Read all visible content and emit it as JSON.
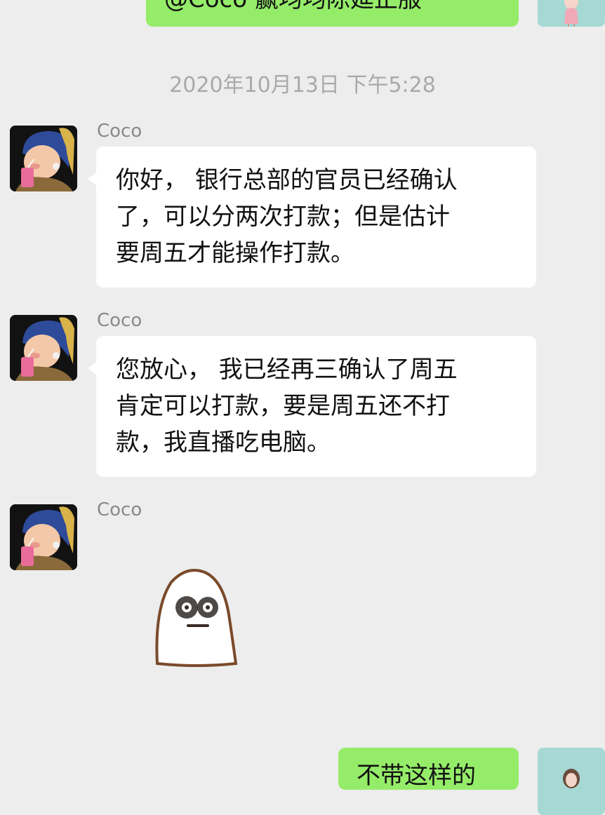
{
  "messages": {
    "out_top": {
      "text": "@Coco 赢均均陈延正服"
    },
    "timestamp": "2020年10月13日 下午5:28",
    "msg1": {
      "sender": "Coco",
      "lines": [
        "你好， 银行总部的官员已经确认",
        "了，可以分两次打款；但是估计",
        "要周五才能操作打款。"
      ]
    },
    "msg2": {
      "sender": "Coco",
      "lines": [
        "您放心， 我已经再三确认了周五",
        "肯定可以打款，要是周五还不打",
        "款，我直播吃电脑。"
      ]
    },
    "msg3": {
      "sender": "Coco",
      "sticker_icon": "ghost-face-sticker"
    },
    "out_bottom": {
      "text": "不带这样的"
    }
  },
  "colors": {
    "background": "#EDEDED",
    "outgoing_bubble": "#95EC69",
    "incoming_bubble": "#FFFFFF",
    "timestamp_text": "#A9A9A9",
    "sender_name": "#8A8A8A"
  },
  "icons": {
    "coco_avatar": "girl-with-pearl-earring-avatar",
    "my_avatar": "girl-portrait-avatar"
  }
}
